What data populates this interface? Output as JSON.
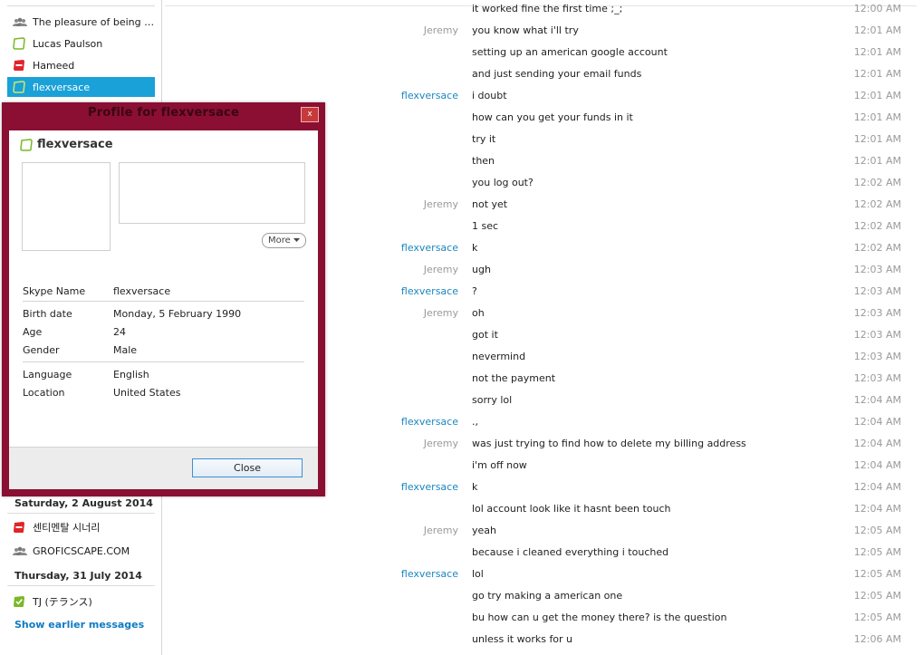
{
  "sidebar": {
    "contacts": [
      {
        "label": "The pleasure of being cu...",
        "icon": "group-icon",
        "status": "group"
      },
      {
        "label": "Lucas Paulson",
        "icon": "offline-status-icon",
        "status": "offline"
      },
      {
        "label": "Hameed",
        "icon": "do-not-disturb-status-icon",
        "status": "dnd"
      },
      {
        "label": "flexversace",
        "icon": "offline-status-icon",
        "status": "offline",
        "selected": true
      }
    ],
    "date_saturday": "Saturday, 2 August 2014",
    "contacts_saturday": [
      {
        "label": "센티멘탈 시너리",
        "icon": "do-not-disturb-status-icon",
        "status": "dnd"
      },
      {
        "label": "GROFICSCAPE.COM",
        "icon": "group-icon",
        "status": "group"
      }
    ],
    "date_thursday": "Thursday, 31 July 2014",
    "contacts_thursday": [
      {
        "label": "TJ (テランス)",
        "icon": "online-status-icon",
        "status": "online"
      }
    ],
    "show_earlier": "Show earlier messages"
  },
  "dialog": {
    "title": "Profile for flexversace",
    "close_x": "x",
    "profile_name": "flexversace",
    "more_label": "More",
    "fields": {
      "skype_name": {
        "k": "Skype Name",
        "v": "flexversace"
      },
      "birth_date": {
        "k": "Birth date",
        "v": "Monday, 5 February 1990"
      },
      "age": {
        "k": "Age",
        "v": "24"
      },
      "gender": {
        "k": "Gender",
        "v": "Male"
      },
      "language": {
        "k": "Language",
        "v": "English"
      },
      "location": {
        "k": "Location",
        "v": "United States"
      }
    },
    "close_button": "Close"
  },
  "chat": {
    "messages": [
      {
        "sender": "",
        "side": "",
        "text": "it worked fine the first time ;_;",
        "time": "12:00 AM"
      },
      {
        "sender": "Jeremy",
        "side": "them",
        "text": "you know what i'll try",
        "time": "12:01 AM"
      },
      {
        "sender": "",
        "side": "",
        "text": "setting up an american google account",
        "time": "12:01 AM"
      },
      {
        "sender": "",
        "side": "",
        "text": "and just sending your email funds",
        "time": "12:01 AM"
      },
      {
        "sender": "flexversace",
        "side": "me",
        "text": "i doubt",
        "time": "12:01 AM"
      },
      {
        "sender": "",
        "side": "",
        "text": "how can you get your funds in it",
        "time": "12:01 AM"
      },
      {
        "sender": "",
        "side": "",
        "text": "try it",
        "time": "12:01 AM"
      },
      {
        "sender": "",
        "side": "",
        "text": "then",
        "time": "12:01 AM"
      },
      {
        "sender": "",
        "side": "",
        "text": "you log out?",
        "time": "12:02 AM"
      },
      {
        "sender": "Jeremy",
        "side": "them",
        "text": "not yet",
        "time": "12:02 AM"
      },
      {
        "sender": "",
        "side": "",
        "text": "1 sec",
        "time": "12:02 AM"
      },
      {
        "sender": "flexversace",
        "side": "me",
        "text": "k",
        "time": "12:02 AM"
      },
      {
        "sender": "Jeremy",
        "side": "them",
        "text": "ugh",
        "time": "12:03 AM"
      },
      {
        "sender": "flexversace",
        "side": "me",
        "text": "?",
        "time": "12:03 AM"
      },
      {
        "sender": "Jeremy",
        "side": "them",
        "text": "oh",
        "time": "12:03 AM"
      },
      {
        "sender": "",
        "side": "",
        "text": "got it",
        "time": "12:03 AM"
      },
      {
        "sender": "",
        "side": "",
        "text": "nevermind",
        "time": "12:03 AM"
      },
      {
        "sender": "",
        "side": "",
        "text": "not the payment",
        "time": "12:03 AM"
      },
      {
        "sender": "",
        "side": "",
        "text": "sorry lol",
        "time": "12:04 AM"
      },
      {
        "sender": "flexversace",
        "side": "me",
        "text": ".,",
        "time": "12:04 AM"
      },
      {
        "sender": "Jeremy",
        "side": "them",
        "text": "was just trying to find how to delete my billing address",
        "time": "12:04 AM"
      },
      {
        "sender": "",
        "side": "",
        "text": "i'm off now",
        "time": "12:04 AM"
      },
      {
        "sender": "flexversace",
        "side": "me",
        "text": "k",
        "time": "12:04 AM"
      },
      {
        "sender": "",
        "side": "",
        "text": "lol account look like it hasnt been touch",
        "time": "12:04 AM"
      },
      {
        "sender": "Jeremy",
        "side": "them",
        "text": "yeah",
        "time": "12:05 AM"
      },
      {
        "sender": "",
        "side": "",
        "text": "because i cleaned everything i touched",
        "time": "12:05 AM"
      },
      {
        "sender": "flexversace",
        "side": "me",
        "text": "lol",
        "time": "12:05 AM"
      },
      {
        "sender": "",
        "side": "",
        "text": "go try making a american one",
        "time": "12:05 AM"
      },
      {
        "sender": "",
        "side": "",
        "text": "bu how can u get the money there? is the question",
        "time": "12:05 AM"
      },
      {
        "sender": "",
        "side": "",
        "text": "unless it works for u",
        "time": "12:06 AM"
      }
    ]
  },
  "colors": {
    "selected": "#1aa1d8",
    "dialog_frame": "#8a0f32",
    "link_blue": "#0f7bc2",
    "me_sender": "#1a86c0",
    "online": "#7ab826",
    "dnd": "#e0242a"
  }
}
